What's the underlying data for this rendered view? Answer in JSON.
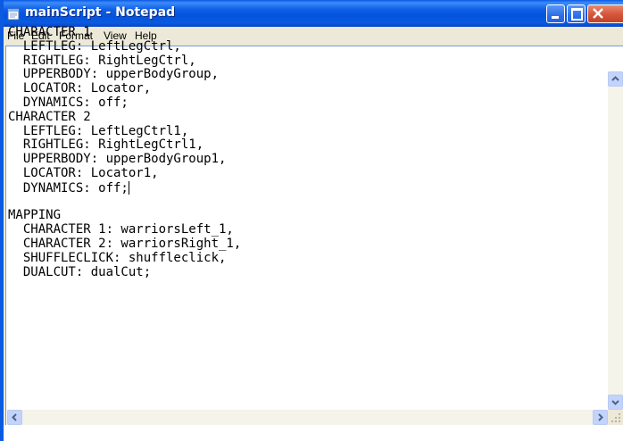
{
  "window": {
    "title": "mainScript - Notepad",
    "icon": "notepad-icon",
    "controls": [
      "minimize-icon",
      "maximize-icon",
      "close-icon"
    ]
  },
  "menu": {
    "file": "File",
    "edit": "Edit",
    "format": "Format",
    "view": "View",
    "help": "Help"
  },
  "editor": {
    "lines": [
      "CHARACTER 1",
      "  LEFTLEG: LeftLegCtrl,",
      "  RIGHTLEG: RightLegCtrl,",
      "  UPPERBODY: upperBodyGroup,",
      "  LOCATOR: Locator,",
      "  DYNAMICS: off;",
      "CHARACTER 2",
      "  LEFTLEG: LeftLegCtrl1,",
      "  RIGHTLEG: RightLegCtrl1,",
      "  UPPERBODY: upperBodyGroup1,",
      "  LOCATOR: Locator1,",
      "  DYNAMICS: off;",
      "",
      "MAPPING",
      "  CHARACTER 1: warriorsLeft_1,",
      "  CHARACTER 2: warriorsRight_1,",
      "  SHUFFLECLICK: shuffleclick,",
      "  DUALCUT: dualCut;"
    ],
    "caret_line": 11
  },
  "scrollbars": {
    "vertical": [
      "scroll-up-icon",
      "scroll-down-icon"
    ],
    "horizontal": [
      "scroll-left-icon",
      "scroll-right-icon"
    ]
  }
}
